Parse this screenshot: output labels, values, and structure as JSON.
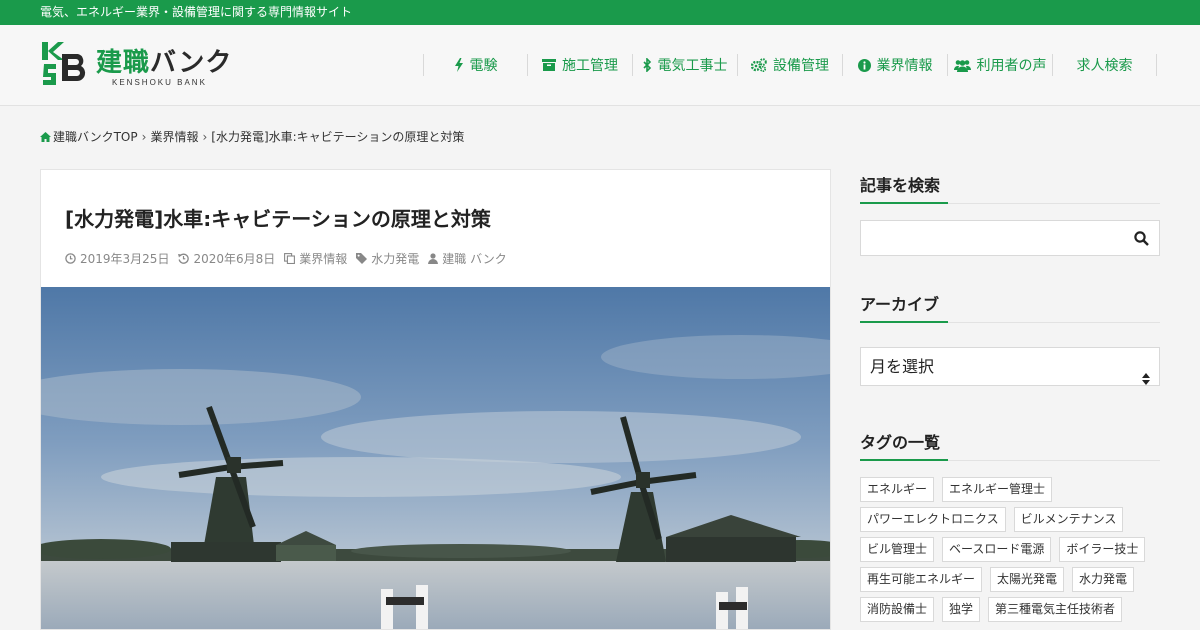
{
  "topbar": {
    "tagline": "電気、エネルギー業界・設備管理に関する専門情報サイト"
  },
  "logo": {
    "brand_main": "建職",
    "brand_kana": "バンク",
    "sub": "KENSHOKU BANK",
    "mark_letters": "K S B"
  },
  "nav": {
    "items": [
      {
        "label": "電験",
        "icon": "bolt-icon"
      },
      {
        "label": "施工管理",
        "icon": "archive-icon"
      },
      {
        "label": "電気工事士",
        "icon": "bluetooth-icon"
      },
      {
        "label": "設備管理",
        "icon": "gears-icon"
      },
      {
        "label": "業界情報",
        "icon": "info-circle-icon"
      },
      {
        "label": "利用者の声",
        "icon": "users-icon"
      },
      {
        "label": "求人検索",
        "icon": ""
      }
    ]
  },
  "breadcrumb": {
    "home": "建職バンクTOP",
    "category": "業界情報",
    "current": "[水力発電]水車:キャビテーションの原理と対策"
  },
  "article": {
    "title": "[水力発電]水車:キャビテーションの原理と対策",
    "published": "2019年3月25日",
    "updated": "2020年6月8日",
    "category": "業界情報",
    "tag": "水力発電",
    "author": "建職 バンク",
    "hero_image": "windmills-reflecting-on-river"
  },
  "sidebar": {
    "search_heading": "記事を検索",
    "search_placeholder": "",
    "archive_heading": "アーカイブ",
    "archive_select_value": "月を選択",
    "tags_heading": "タグの一覧",
    "tags": [
      "エネルギー",
      "エネルギー管理士",
      "パワーエレクトロニクス",
      "ビルメンテナンス",
      "ビル管理士",
      "ベースロード電源",
      "ボイラー技士",
      "再生可能エネルギー",
      "太陽光発電",
      "水力発電",
      "消防設備士",
      "独学",
      "第三種電気主任技術者"
    ]
  },
  "colors": {
    "brand": "#1a9a4b",
    "background": "#f4f4f4",
    "card": "#ffffff"
  }
}
